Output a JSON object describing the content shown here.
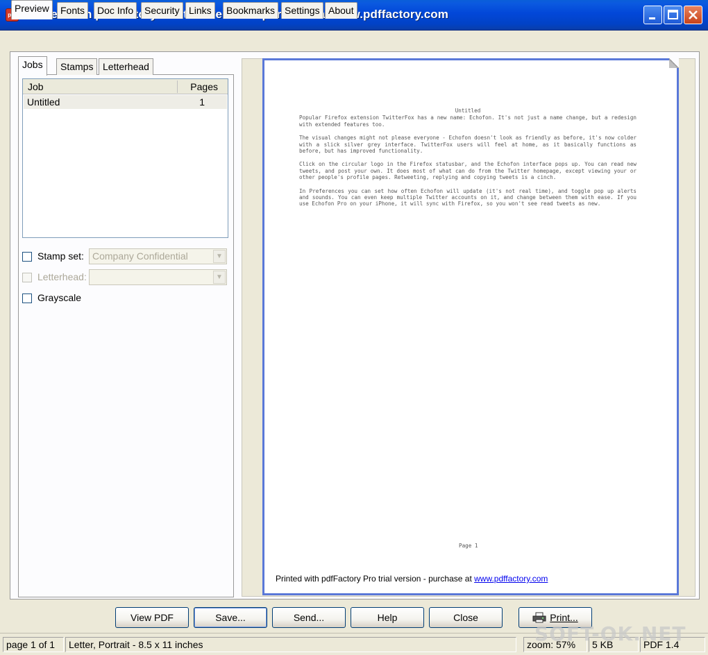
{
  "window": {
    "title": "Printed with pdfFactory Pro trial version - purchase at www.pdffactory.com",
    "app_icon_text": "pdf"
  },
  "main_tabs": [
    {
      "label": "Preview"
    },
    {
      "label": "Fonts"
    },
    {
      "label": "Doc Info"
    },
    {
      "label": "Security"
    },
    {
      "label": "Links"
    },
    {
      "label": "Bookmarks"
    },
    {
      "label": "Settings"
    },
    {
      "label": "About"
    }
  ],
  "sub_tabs": [
    {
      "label": "Jobs"
    },
    {
      "label": "Stamps"
    },
    {
      "label": "Letterhead"
    }
  ],
  "jobs": {
    "headers": {
      "job": "Job",
      "pages": "Pages"
    },
    "rows": [
      {
        "name": "Untitled",
        "pages": "1"
      }
    ]
  },
  "options": {
    "stamp_set_label": "Stamp set:",
    "stamp_set_value": "Company Confidential",
    "letterhead_label": "Letterhead:",
    "letterhead_value": "",
    "grayscale_label": "Grayscale"
  },
  "document": {
    "title": "Untitled",
    "paragraphs": [
      "Popular Firefox extension TwitterFox has a new name: Echofon. It's not just a name change, but a redesign with extended features too.",
      "The visual changes might not please everyone - Echofon doesn't look as friendly as before, it's now colder with a slick silver grey interface. TwitterFox users will feel at home, as it basically functions as before, but has improved functionality.",
      "Click on the circular logo in the Firefox statusbar, and the Echofon interface pops up. You can read new tweets, and post your own. It does most of what can do from the Twitter homepage, except viewing your or other people's profile pages. Retweeting, replying and copying tweets is a cinch.",
      "In Preferences you can set how often Echofon will update (it's not real time), and toggle pop up alerts and sounds. You can even keep multiple Twitter accounts on it, and change between them with ease. If you use Echofon Pro on your iPhone, it will sync with Firefox, so you won't see read tweets as new."
    ],
    "page_number": "Page 1",
    "footer_text": "Printed with pdfFactory Pro trial version - purchase at ",
    "footer_link": "www.pdffactory.com"
  },
  "buttons": {
    "view_pdf": "View PDF",
    "save": "Save...",
    "send": "Send...",
    "help": "Help",
    "close": "Close",
    "print": "Print..."
  },
  "status": {
    "page": "page 1 of 1",
    "paper": "Letter, Portrait - 8.5 x 11 inches",
    "zoom": "zoom: 57%",
    "size": "5 KB",
    "pdf_version": "PDF 1.4"
  },
  "watermark": "SOFT-OK.NET",
  "colors": {
    "title_bar": "#0247d8",
    "page_border": "#5a78d8",
    "window_bg": "#ece9d8"
  }
}
